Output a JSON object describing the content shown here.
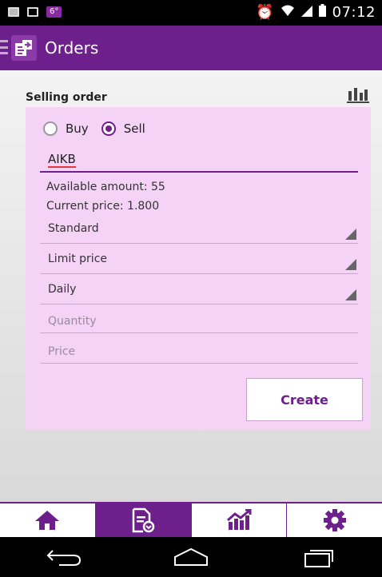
{
  "status_bar": {
    "notification_badge": "6°",
    "time": "07:12"
  },
  "app_bar": {
    "title": "Orders"
  },
  "order_form": {
    "section_title": "Selling order",
    "radio_buy_label": "Buy",
    "radio_sell_label": "Sell",
    "selected_side": "Sell",
    "symbol_value": "AIKB",
    "available_amount": "Available amount: 55",
    "current_price": "Current price: 1.800",
    "order_type": "Standard",
    "price_type": "Limit price",
    "validity": "Daily",
    "quantity_placeholder": "Quantity",
    "price_placeholder": "Price",
    "create_label": "Create"
  },
  "bottom_nav": {
    "items": [
      "home-icon",
      "orders-icon",
      "chart-icon",
      "gear-icon"
    ],
    "active": "orders-icon"
  },
  "colors": {
    "brand": "#6d1f8c",
    "card": "#f4d3f6"
  }
}
